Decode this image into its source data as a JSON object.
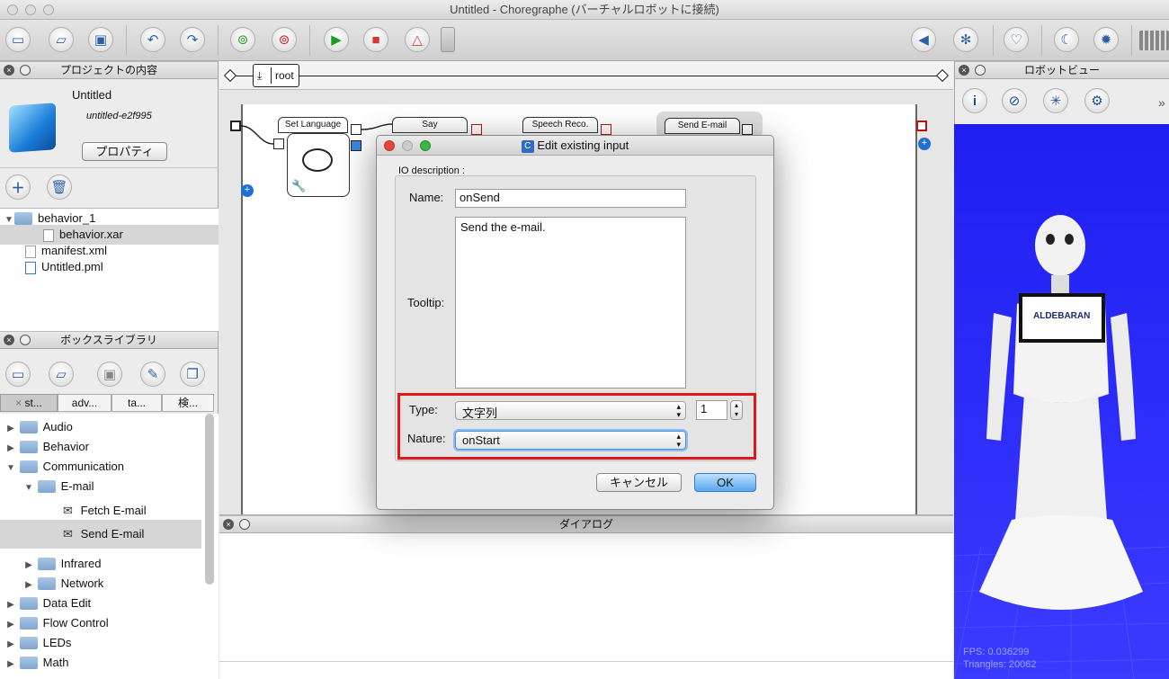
{
  "window": {
    "title": "Untitled - Choregraphe (バーチャルロボットに接続)"
  },
  "toolbar": {
    "icons": [
      "new-window-icon",
      "open-folder-icon",
      "save-icon",
      "undo-icon",
      "redo-icon",
      "connect-icon",
      "disconnect-icon",
      "play-icon",
      "stop-icon",
      "debug-icon",
      "volume-icon",
      "posture-icon",
      "heart-icon",
      "sleep-icon",
      "settings-icon",
      "battery-icon"
    ]
  },
  "project_panel": {
    "title": "プロジェクトの内容",
    "project_name": "Untitled",
    "project_id": "untitled-e2f995",
    "properties_button": "プロパティ",
    "files": [
      {
        "label": "behavior_1",
        "type": "folder"
      },
      {
        "label": "behavior.xar",
        "type": "file"
      },
      {
        "label": "manifest.xml",
        "type": "file"
      },
      {
        "label": "Untitled.pml",
        "type": "file"
      }
    ]
  },
  "box_library": {
    "title": "ボックスライブラリ",
    "tabs": [
      "st...",
      "adv...",
      "ta...",
      "検..."
    ],
    "items": [
      {
        "label": "Audio"
      },
      {
        "label": "Behavior"
      },
      {
        "label": "Communication"
      },
      {
        "label": "E-mail"
      },
      {
        "label": "Fetch E-mail"
      },
      {
        "label": "Send E-mail"
      },
      {
        "label": "Infrared"
      },
      {
        "label": "Network"
      },
      {
        "label": "Data Edit"
      },
      {
        "label": "Flow Control"
      },
      {
        "label": "LEDs"
      },
      {
        "label": "Math"
      }
    ]
  },
  "flow": {
    "breadcrumb": "root",
    "boxes": [
      "Set Language",
      "Say",
      "Speech Reco.",
      "Send E-mail"
    ]
  },
  "dialog_panel": {
    "title": "ダイアログ"
  },
  "robot_view": {
    "title": "ロボットビュー",
    "brand": "ALDEBARAN",
    "fps": "FPS: 0.036299",
    "triangles": "Triangles: 20062"
  },
  "edit_dialog": {
    "title": "Edit existing input",
    "group_label": "IO description :",
    "name_label": "Name:",
    "name_value": "onSend",
    "tooltip_label": "Tooltip:",
    "tooltip_value": "Send the e-mail.",
    "type_label": "Type:",
    "type_value": "文字列",
    "size_value": "1",
    "nature_label": "Nature:",
    "nature_value": "onStart",
    "cancel_button": "キャンセル",
    "ok_button": "OK",
    "highlight_color": "#e0161b"
  }
}
